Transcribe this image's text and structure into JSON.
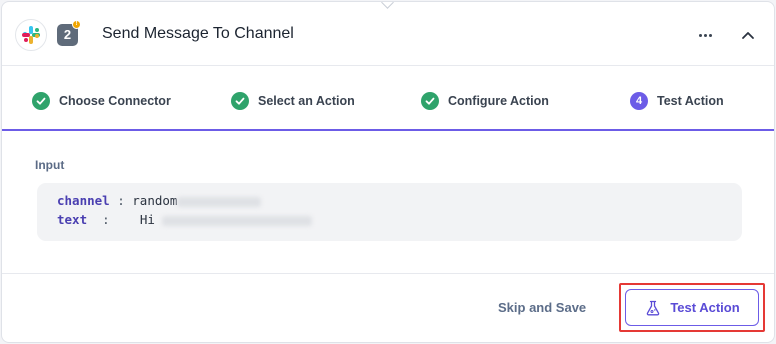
{
  "header": {
    "app_icon": "slack-logo",
    "step_number": "2",
    "warning_icon": "info-badge-icon",
    "title": "Send Message To Channel",
    "more_icon": "more-horizontal-icon",
    "collapse_icon": "chevron-up-icon"
  },
  "stepper": {
    "steps": [
      {
        "label": "Choose Connector",
        "state": "done",
        "icon": "check-circle-icon"
      },
      {
        "label": "Select an Action",
        "state": "done",
        "icon": "check-circle-icon"
      },
      {
        "label": "Configure Action",
        "state": "done",
        "icon": "check-circle-icon"
      },
      {
        "label": "Test Action",
        "state": "active",
        "number": "4"
      }
    ]
  },
  "input": {
    "label": "Input",
    "fields": [
      {
        "key": "channel",
        "separator": ":",
        "value": "random"
      },
      {
        "key": "text",
        "separator": ":",
        "value": "Hi"
      }
    ]
  },
  "footer": {
    "skip_label": "Skip and Save",
    "test_label": "Test Action",
    "test_icon": "flask-icon"
  },
  "colors": {
    "accent": "#6c5ce7",
    "success": "#2fa36b",
    "highlight": "#e53935"
  }
}
